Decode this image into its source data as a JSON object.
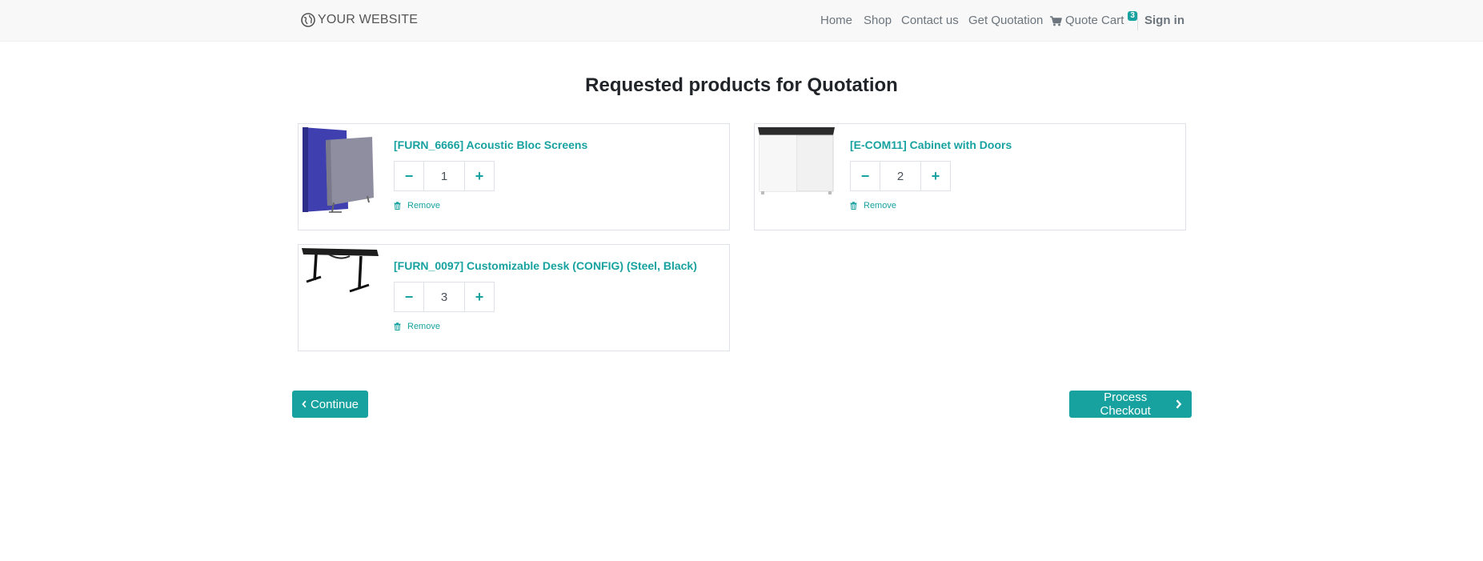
{
  "brand": {
    "name": "YOUR WEBSITE",
    "icon": "globe-icon"
  },
  "nav": {
    "home": "Home",
    "shop": "Shop",
    "contact": "Contact us",
    "quotation": "Get Quotation",
    "cart_label": "Quote Cart",
    "cart_icon": "cart-icon",
    "cart_count": "3",
    "signin": "Sign in"
  },
  "page": {
    "title": "Requested products for Quotation"
  },
  "products": [
    {
      "name": "[FURN_6666] Acoustic Bloc Screens",
      "quantity": "1",
      "remove_label": "Remove",
      "image": "acoustic-screens"
    },
    {
      "name": "[E-COM11] Cabinet with Doors",
      "quantity": "2",
      "remove_label": "Remove",
      "image": "cabinet"
    },
    {
      "name": "[FURN_0097] Customizable Desk (CONFIG) (Steel, Black)",
      "quantity": "3",
      "remove_label": "Remove",
      "image": "desk"
    }
  ],
  "actions": {
    "continue_label": "Continue",
    "checkout_label": "Process Checkout"
  },
  "colors": {
    "accent": "#17a2a0",
    "navbar_bg": "#f8f8f8",
    "border": "#dee2e6"
  }
}
